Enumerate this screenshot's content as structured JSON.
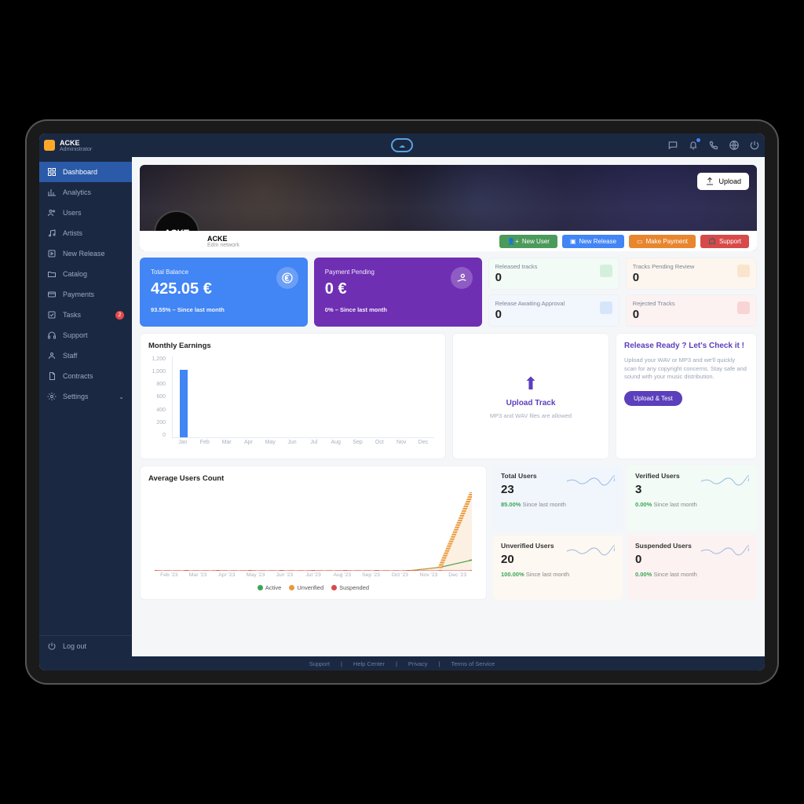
{
  "topbar": {
    "user_name": "ACKE",
    "user_role": "Administrator"
  },
  "sidebar": {
    "items": [
      {
        "label": "Dashboard",
        "active": true
      },
      {
        "label": "Analytics"
      },
      {
        "label": "Users"
      },
      {
        "label": "Artists"
      },
      {
        "label": "New Release"
      },
      {
        "label": "Catalog"
      },
      {
        "label": "Payments"
      },
      {
        "label": "Tasks",
        "badge": "2"
      },
      {
        "label": "Support"
      },
      {
        "label": "Staff"
      },
      {
        "label": "Contracts"
      },
      {
        "label": "Settings",
        "caret": true
      }
    ],
    "logout": "Log out"
  },
  "banner": {
    "name": "ACKE",
    "subtitle": "Edm network",
    "avatar_text": "ACKE",
    "upload_label": "Upload",
    "actions": {
      "new_user": "New User",
      "new_release": "New Release",
      "make_payment": "Make Payment",
      "support": "Support"
    }
  },
  "stats_big": {
    "total_balance": {
      "label": "Total Balance",
      "value": "425.05 €",
      "delta": "93.55% – Since last month"
    },
    "payment_pending": {
      "label": "Payment Pending",
      "value": "0 €",
      "delta": "0% – Since last month"
    }
  },
  "stats_mini": {
    "released": {
      "label": "Released tracks",
      "value": "0"
    },
    "awaiting": {
      "label": "Release Awaiting Approval",
      "value": "0"
    },
    "pending_review": {
      "label": "Tracks Pending Review",
      "value": "0"
    },
    "rejected": {
      "label": "Rejected Tracks",
      "value": "0"
    }
  },
  "monthly": {
    "title": "Monthly Earnings"
  },
  "upload": {
    "title": "Upload Track",
    "hint": "MP3 and WAV files are allowed"
  },
  "release_check": {
    "title": "Release Ready ? Let's Check it !",
    "desc": "Upload your WAV or MP3 and we'll quickly scan for any copyright concerns. Stay safe and sound with your music distribution.",
    "button": "Upload & Test"
  },
  "avg_users": {
    "title": "Average Users Count",
    "legend": {
      "active": "Active",
      "unverified": "Unverified",
      "suspended": "Suspended"
    }
  },
  "user_stats": {
    "total": {
      "label": "Total Users",
      "value": "23",
      "pct": "85.00%",
      "since": " Since last month"
    },
    "verified": {
      "label": "Verified Users",
      "value": "3",
      "pct": "0.00%",
      "since": " Since last month"
    },
    "unverified": {
      "label": "Unverified Users",
      "value": "20",
      "pct": "100.00%",
      "since": " Since last month"
    },
    "suspended": {
      "label": "Suspended Users",
      "value": "0",
      "pct": "0.00%",
      "since": " Since last month"
    }
  },
  "footer": {
    "support": "Support",
    "help": "Help Center",
    "privacy": "Privacy",
    "tos": "Terms of Service"
  },
  "chart_data": [
    {
      "id": "monthly_earnings",
      "type": "bar",
      "title": "Monthly Earnings",
      "categories": [
        "Jan",
        "Feb",
        "Mar",
        "Apr",
        "May",
        "Jun",
        "Jul",
        "Aug",
        "Sep",
        "Oct",
        "Nov",
        "Dec"
      ],
      "values": [
        1000,
        0,
        0,
        0,
        0,
        0,
        0,
        0,
        0,
        0,
        0,
        0
      ],
      "ylabel": "",
      "ylim": [
        0,
        1200
      ],
      "yticks": [
        0,
        200,
        400,
        600,
        800,
        1000,
        1200
      ]
    },
    {
      "id": "average_users_count",
      "type": "line",
      "title": "Average Users Count",
      "categories": [
        "Feb '23",
        "Mar '23",
        "Apr '23",
        "May '23",
        "Jun '23",
        "Jul '23",
        "Aug '23",
        "Sep '23",
        "Oct '23",
        "Nov '23",
        "Dec '23"
      ],
      "series": [
        {
          "name": "Active",
          "color": "#3aa556",
          "values": [
            0,
            0,
            0,
            0,
            0,
            0,
            0,
            0,
            0,
            1,
            3
          ]
        },
        {
          "name": "Unverified",
          "color": "#e89a3a",
          "values": [
            0,
            0,
            0,
            0,
            0,
            0,
            0,
            0,
            0,
            1,
            22
          ]
        },
        {
          "name": "Suspended",
          "color": "#d84a4a",
          "values": [
            0,
            0,
            0,
            0,
            0,
            0,
            0,
            0,
            0,
            0,
            0
          ]
        }
      ],
      "ylim": [
        0,
        22
      ]
    }
  ]
}
